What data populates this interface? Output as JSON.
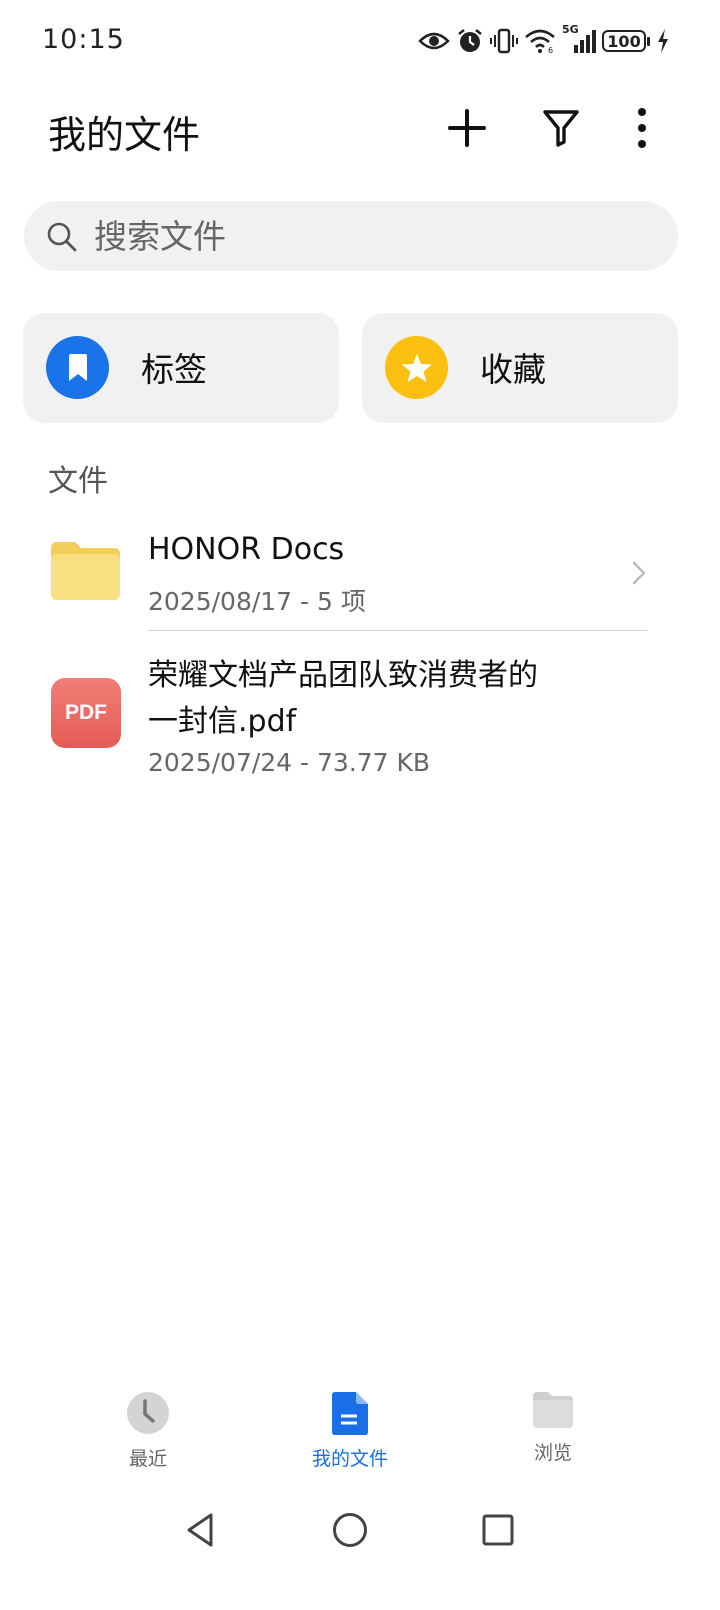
{
  "status_bar": {
    "time": "10:15",
    "network": "5G",
    "battery": "100",
    "icons": [
      "eye-icon",
      "alarm-icon",
      "vibrate-icon",
      "wifi-icon",
      "signal-icon",
      "battery-icon",
      "charging-icon"
    ]
  },
  "header": {
    "title": "我的文件",
    "actions": [
      "plus-icon",
      "filter-icon",
      "more-icon"
    ]
  },
  "search": {
    "placeholder": "搜索文件"
  },
  "quick_cards": [
    {
      "label": "标签",
      "icon": "bookmark-icon",
      "color": "#1a73e8"
    },
    {
      "label": "收藏",
      "icon": "star-icon",
      "color": "#fbbf10"
    }
  ],
  "section": {
    "title": "文件"
  },
  "files": [
    {
      "name": "HONOR Docs",
      "meta": "2025/08/17 - 5 项",
      "icon": "folder-icon"
    },
    {
      "name_line1": "荣耀文档产品团队致消费者的",
      "name_line2": "一封信.pdf",
      "meta": "2025/07/24 - 73.77 KB",
      "icon_text": "PDF"
    }
  ],
  "bottom_nav": {
    "items": [
      {
        "label": "最近",
        "icon": "clock-icon",
        "active": false
      },
      {
        "label": "我的文件",
        "icon": "document-icon",
        "active": true
      },
      {
        "label": "浏览",
        "icon": "folder-icon",
        "active": false
      }
    ],
    "active_color": "#1a6ee6"
  }
}
